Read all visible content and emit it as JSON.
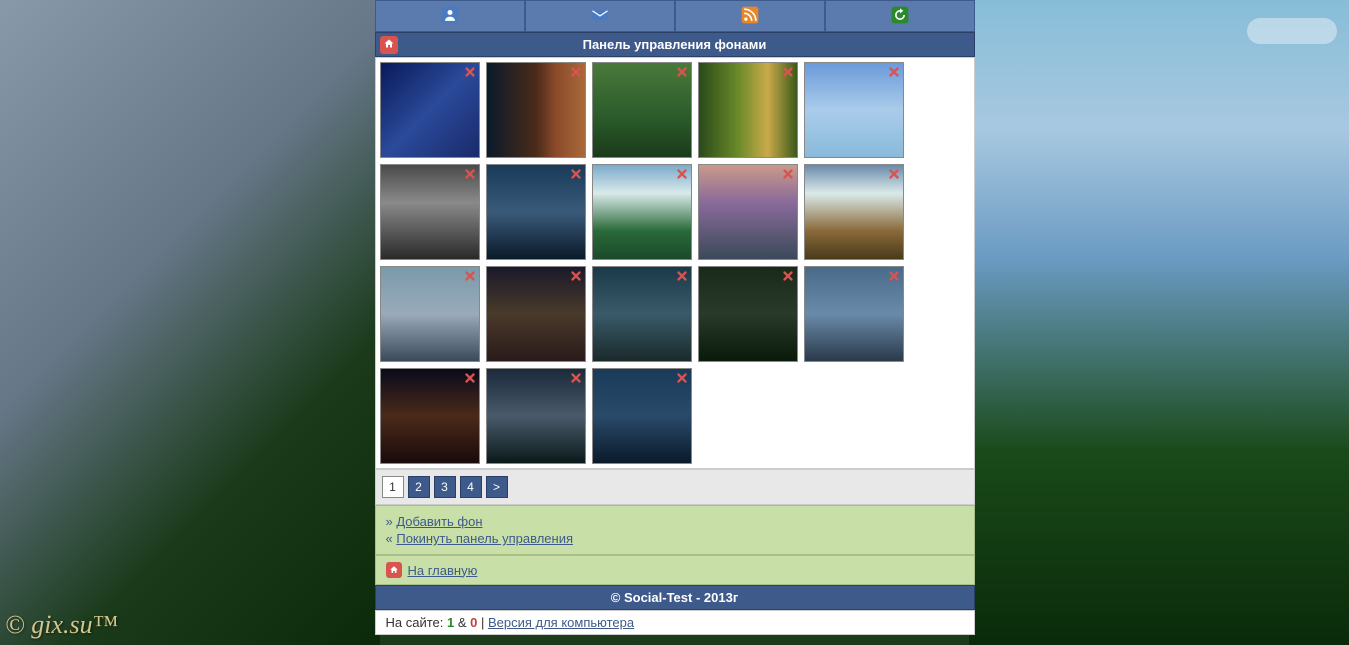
{
  "watermark": "© gix.su™",
  "titlebar": "Панель управления фонами",
  "topnav": {
    "items": [
      "profile",
      "messages",
      "rss",
      "refresh"
    ]
  },
  "thumbnails": [
    {
      "id": "bg1",
      "class": "t1"
    },
    {
      "id": "bg2",
      "class": "t2"
    },
    {
      "id": "bg3",
      "class": "t3"
    },
    {
      "id": "bg4",
      "class": "t4"
    },
    {
      "id": "bg5",
      "class": "t5"
    },
    {
      "id": "bg6",
      "class": "t6"
    },
    {
      "id": "bg7",
      "class": "t7"
    },
    {
      "id": "bg8",
      "class": "t8"
    },
    {
      "id": "bg9",
      "class": "t9"
    },
    {
      "id": "bg10",
      "class": "t10"
    },
    {
      "id": "bg11",
      "class": "t11"
    },
    {
      "id": "bg12",
      "class": "t12"
    },
    {
      "id": "bg13",
      "class": "t13"
    },
    {
      "id": "bg14",
      "class": "t14"
    },
    {
      "id": "bg15",
      "class": "t15"
    },
    {
      "id": "bg16",
      "class": "t16"
    },
    {
      "id": "bg17",
      "class": "t17"
    },
    {
      "id": "bg18",
      "class": "t18"
    }
  ],
  "pagination": {
    "pages": [
      "1",
      "2",
      "3",
      "4",
      ">"
    ],
    "active": "1"
  },
  "links": {
    "add_prefix": "» ",
    "add": "Добавить фон",
    "leave_prefix": "« ",
    "leave": "Покинуть панель управления",
    "home": "На главную"
  },
  "footer": "© Social-Test - 2013г",
  "stats": {
    "label": "На сайте: ",
    "online": "1",
    "amp": " & ",
    "guests": "0",
    "sep": " | ",
    "version": "Версия для компьютера"
  }
}
